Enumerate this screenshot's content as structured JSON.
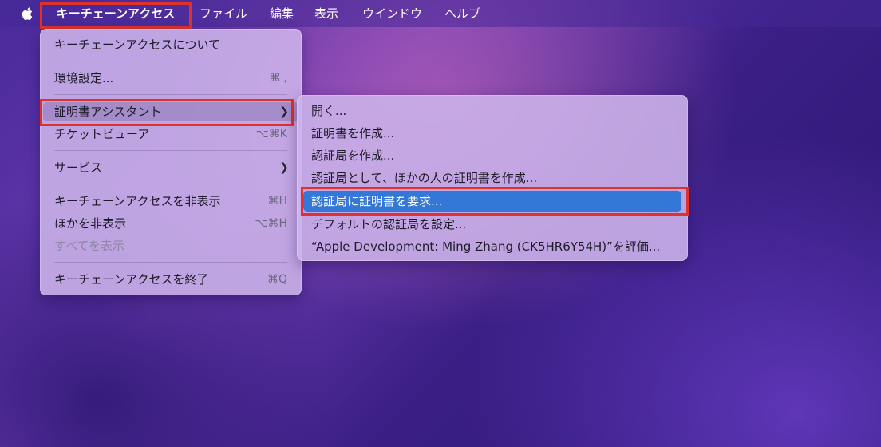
{
  "menubar": {
    "apple_icon": "apple-logo-icon",
    "app_menu": "キーチェーンアクセス",
    "items": [
      "ファイル",
      "編集",
      "表示",
      "ウインドウ",
      "ヘルプ"
    ]
  },
  "app_menu": {
    "about": "キーチェーンアクセスについて",
    "prefs": {
      "label": "環境設定...",
      "shortcut": "⌘ ,"
    },
    "cert_assistant": "証明書アシスタント",
    "ticket_viewer": {
      "label": "チケットビューア",
      "shortcut": "⌥⌘K"
    },
    "services": "サービス",
    "hide": {
      "label": "キーチェーンアクセスを非表示",
      "shortcut": "⌘H"
    },
    "hide_others": {
      "label": "ほかを非表示",
      "shortcut": "⌥⌘H"
    },
    "show_all": "すべてを表示",
    "quit": {
      "label": "キーチェーンアクセスを終了",
      "shortcut": "⌘Q"
    }
  },
  "cert_submenu": {
    "open": "開く...",
    "create_cert": "証明書を作成...",
    "create_ca": "認証局を作成...",
    "create_as_ca": "認証局として、ほかの人の証明書を作成...",
    "request_from_ca": "認証局に証明書を要求...",
    "set_default_ca": "デフォルトの認証局を設定...",
    "evaluate": "“Apple Development: Ming Zhang (CK5HR6Y54H)”を評価..."
  },
  "colors": {
    "selection": "#3478d7",
    "annotation_box": "#e0322b"
  }
}
